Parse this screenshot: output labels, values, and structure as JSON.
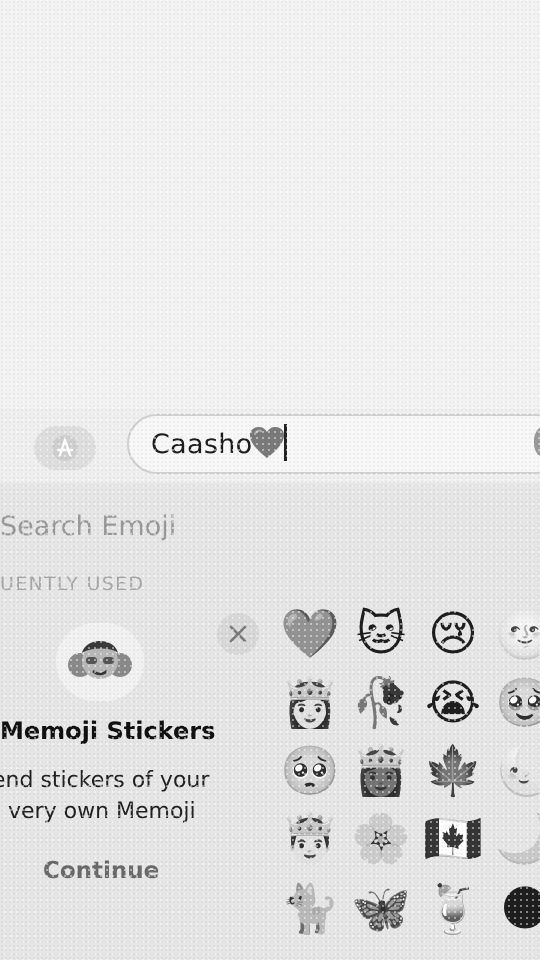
{
  "composer": {
    "text": "Caasho",
    "inline_emoji": "grey-heart"
  },
  "keyboard": {
    "search_placeholder": "Search Emoji",
    "section_label": "UENTLY USED",
    "memoji": {
      "title": "Memoji Stickers",
      "desc_line1": "end stickers of your",
      "desc_line2": "very own Memoji",
      "continue": "Continue"
    },
    "emojis": [
      {
        "name": "grey-heart-emoji",
        "glyph": "🩶"
      },
      {
        "name": "cat-face-emoji",
        "glyph": "🐱"
      },
      {
        "name": "crying-face-emoji",
        "glyph": "😢"
      },
      {
        "name": "moon-face-emoji",
        "glyph": "🌝"
      },
      {
        "name": "princess-emoji",
        "glyph": "👸🏻"
      },
      {
        "name": "wilted-rose-emoji",
        "glyph": "🥀"
      },
      {
        "name": "loudly-crying-face-emoji",
        "glyph": "😭"
      },
      {
        "name": "face-holding-back-tears-emoji",
        "glyph": "🥹"
      },
      {
        "name": "pleading-face-emoji",
        "glyph": "🥺"
      },
      {
        "name": "princess-medium-skin-emoji",
        "glyph": "👸🏾"
      },
      {
        "name": "maple-leaf-emoji",
        "glyph": "🍁"
      },
      {
        "name": "last-quarter-moon-face-emoji",
        "glyph": "🌜"
      },
      {
        "name": "prince-emoji",
        "glyph": "🤴🏻"
      },
      {
        "name": "cherry-blossom-emoji",
        "glyph": "🌸"
      },
      {
        "name": "canada-flag-emoji",
        "glyph": "🇨🇦"
      },
      {
        "name": "crescent-moon-emoji",
        "glyph": "🌙"
      },
      {
        "name": "cat-emoji",
        "glyph": "🐈"
      },
      {
        "name": "butterfly-emoji",
        "glyph": "🦋"
      },
      {
        "name": "tropical-drink-emoji",
        "glyph": "🍹"
      },
      {
        "name": "new-moon-emoji",
        "glyph": "🌑"
      }
    ]
  }
}
